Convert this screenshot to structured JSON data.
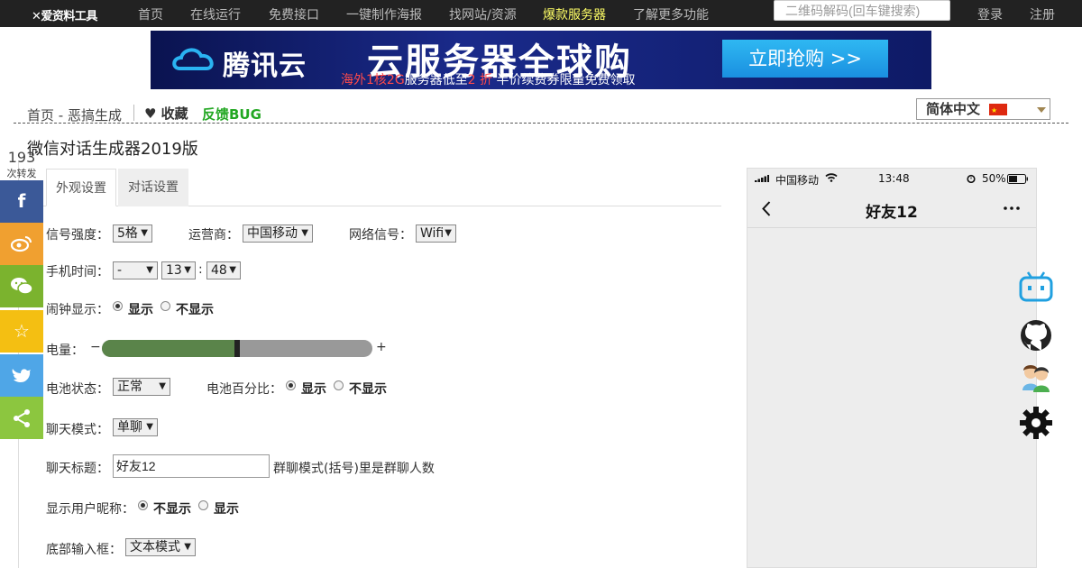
{
  "topnav": {
    "logo": "✕爱资料工具",
    "items": [
      "首页",
      "在线运行",
      "免费接口",
      "一键制作海报",
      "找网站/资源",
      "爆款服务器",
      "了解更多功能"
    ],
    "search_placeholder": "二维码解码(回车键搜索)",
    "login": "登录",
    "register": "注册"
  },
  "banner": {
    "brand": "腾讯云",
    "title": "云服务器全球购",
    "sub_prefix": "海外1核2G",
    "sub_mid": "服务器低至",
    "sub_discount": "2 折",
    "sub_suffix": " 半价续费券限量免费领取",
    "button": "立即抢购 >>"
  },
  "breadcrumb": {
    "path": "首页 - 恶搞生成",
    "favorite": "♥ 收藏",
    "feedback": "反馈BUG"
  },
  "language": {
    "selected": "简体中文"
  },
  "page_title": "微信对话生成器2019版",
  "share": {
    "count": "193",
    "count_label": "次转发",
    "colors": [
      "#3b5998",
      "#f0a030",
      "#7bb32e",
      "#f4bf12",
      "#4fa6e7",
      "#8cc63f"
    ]
  },
  "tabs": [
    "外观设置",
    "对话设置"
  ],
  "form": {
    "signal_label": "信号强度：",
    "signal_value": "5格",
    "carrier_label": "运营商：",
    "carrier_value": "中国移动",
    "network_label": "网络信号：",
    "network_value": "Wifi",
    "time_label": "手机时间：",
    "time_prefix": "-",
    "time_hour": "13",
    "time_colon": ":",
    "time_minute": "48",
    "alarm_label": "闹钟显示：",
    "show": "显示",
    "hide": "不显示",
    "battery_label": "电量：",
    "battery_minus": "−",
    "battery_plus": "+",
    "battery_level": 0.5,
    "battery_state_label": "电池状态：",
    "battery_state_value": "正常",
    "battery_pct_label": "电池百分比：",
    "chat_mode_label": "聊天模式：",
    "chat_mode_value": "单聊",
    "chat_title_label": "聊天标题：",
    "chat_title_value": "好友12",
    "chat_title_hint": "群聊模式(括号)里是群聊人数",
    "nickname_label": "显示用户昵称：",
    "input_box_label": "底部输入框：",
    "input_box_value": "文本模式"
  },
  "phone": {
    "carrier": "中国移动",
    "time": "13:48",
    "battery_pct": "50%",
    "chat_title": "好友12"
  }
}
